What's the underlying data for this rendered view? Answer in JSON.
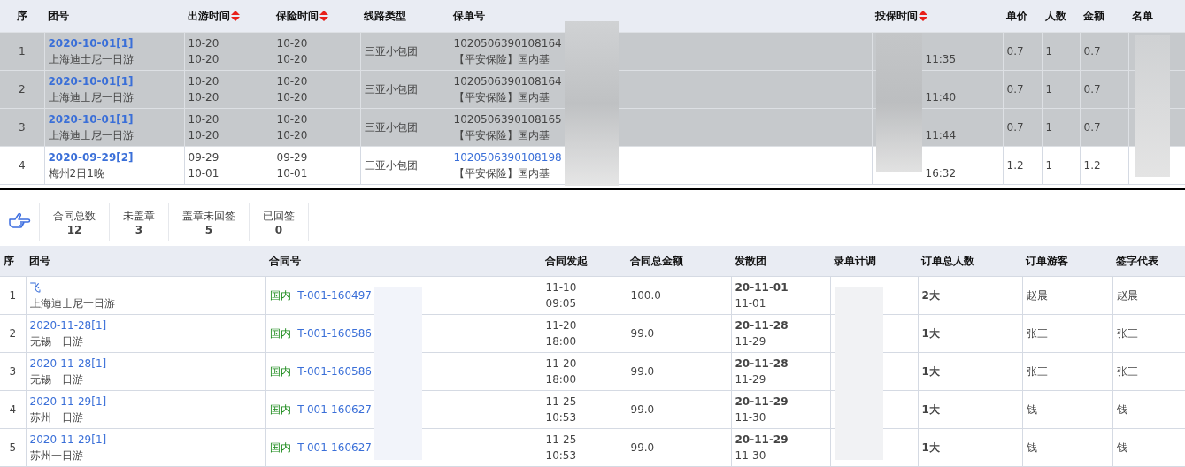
{
  "policy_table": {
    "columns": [
      {
        "label": "序",
        "sortable": false
      },
      {
        "label": "团号",
        "sortable": false
      },
      {
        "label": "出游时间",
        "sortable": true
      },
      {
        "label": "保险时间",
        "sortable": true
      },
      {
        "label": "线路类型",
        "sortable": false
      },
      {
        "label": "保单号",
        "sortable": false
      },
      {
        "label": "投保时间",
        "sortable": true
      },
      {
        "label": "单价",
        "sortable": false
      },
      {
        "label": "人数",
        "sortable": false
      },
      {
        "label": "金额",
        "sortable": false
      },
      {
        "label": "名单",
        "sortable": false
      }
    ],
    "rows": [
      {
        "selected": true,
        "index": "1",
        "group": "2020-10-01[1]",
        "route": "上海迪士尼一日游",
        "travel": [
          "10-20",
          "10-20"
        ],
        "insured": [
          "10-20",
          "10-20"
        ],
        "line_type": "三亚小包团",
        "policy_no": "1020506390108164",
        "policy_link": false,
        "policy_desc": "【平安保险】国内基",
        "time_b": "11:35",
        "price": "0.7",
        "people": "1",
        "amount": "0.7"
      },
      {
        "selected": true,
        "index": "2",
        "group": "2020-10-01[1]",
        "route": "上海迪士尼一日游",
        "travel": [
          "10-20",
          "10-20"
        ],
        "insured": [
          "10-20",
          "10-20"
        ],
        "line_type": "三亚小包团",
        "policy_no": "1020506390108164",
        "policy_link": false,
        "policy_desc": "【平安保险】国内基",
        "time_b": "11:40",
        "price": "0.7",
        "people": "1",
        "amount": "0.7"
      },
      {
        "selected": true,
        "index": "3",
        "group": "2020-10-01[1]",
        "route": "上海迪士尼一日游",
        "travel": [
          "10-20",
          "10-20"
        ],
        "insured": [
          "10-20",
          "10-20"
        ],
        "line_type": "三亚小包团",
        "policy_no": "1020506390108165",
        "policy_link": false,
        "policy_desc": "【平安保险】国内基",
        "time_b": "11:44",
        "price": "0.7",
        "people": "1",
        "amount": "0.7"
      },
      {
        "selected": false,
        "index": "4",
        "group": "2020-09-29[2]",
        "route": "梅州2日1晚",
        "travel": [
          "09-29",
          "10-01"
        ],
        "insured": [
          "09-29",
          "10-01"
        ],
        "line_type": "三亚小包团",
        "policy_no": "1020506390108198",
        "policy_link": true,
        "policy_desc": "【平安保险】国内基",
        "time_b": "16:32",
        "price": "1.2",
        "people": "1",
        "amount": "1.2"
      }
    ]
  },
  "stats": [
    {
      "label": "合同总数",
      "value": "12"
    },
    {
      "label": "未盖章",
      "value": "3"
    },
    {
      "label": "盖章未回签",
      "value": "5"
    },
    {
      "label": "已回签",
      "value": "0"
    }
  ],
  "contract_table": {
    "columns": [
      "序",
      "团号",
      "合同号",
      "合同发起",
      "合同总金额",
      "发散团",
      "录单计调",
      "订单总人数",
      "订单游客",
      "签字代表"
    ],
    "rows": [
      {
        "index": "1",
        "group": "飞",
        "route": "上海迪士尼一日游",
        "region": "国内",
        "contract_no": "T-001-160497",
        "start": [
          "11-10",
          "09:05"
        ],
        "total": "100.0",
        "scatter": [
          "20-11-01",
          "11-01"
        ],
        "headcount": "2大",
        "tourist": "赵晨一",
        "signer": "赵晨一"
      },
      {
        "index": "2",
        "group": "2020-11-28[1]",
        "route": "无锡一日游",
        "region": "国内",
        "contract_no": "T-001-160586",
        "start": [
          "11-20",
          "18:00"
        ],
        "total": "99.0",
        "scatter": [
          "20-11-28",
          "11-29"
        ],
        "headcount": "1大",
        "tourist": "张三",
        "signer": "张三"
      },
      {
        "index": "3",
        "group": "2020-11-28[1]",
        "route": "无锡一日游",
        "region": "国内",
        "contract_no": "T-001-160586",
        "start": [
          "11-20",
          "18:00"
        ],
        "total": "99.0",
        "scatter": [
          "20-11-28",
          "11-29"
        ],
        "headcount": "1大",
        "tourist": "张三",
        "signer": "张三"
      },
      {
        "index": "4",
        "group": "2020-11-29[1]",
        "route": "苏州一日游",
        "region": "国内",
        "contract_no": "T-001-160627",
        "start": [
          "11-25",
          "10:53"
        ],
        "total": "99.0",
        "scatter": [
          "20-11-29",
          "11-30"
        ],
        "headcount": "1大",
        "tourist": "钱",
        "signer": "钱"
      },
      {
        "index": "5",
        "group": "2020-11-29[1]",
        "route": "苏州一日游",
        "region": "国内",
        "contract_no": "T-001-160627",
        "start": [
          "11-25",
          "10:53"
        ],
        "total": "99.0",
        "scatter": [
          "20-11-29",
          "11-30"
        ],
        "headcount": "1大",
        "tourist": "钱",
        "signer": "钱"
      }
    ]
  }
}
